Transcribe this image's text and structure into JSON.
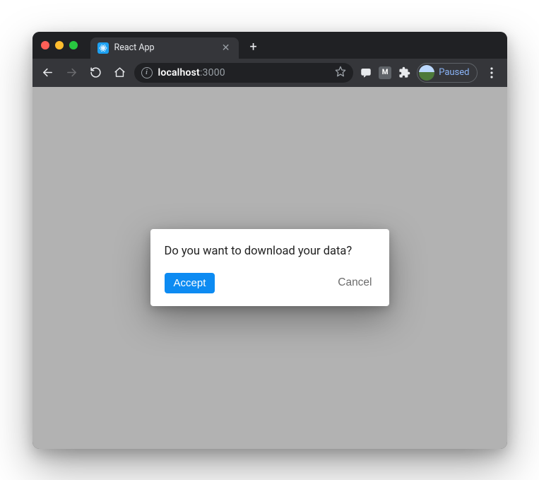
{
  "browser": {
    "tab": {
      "title": "React App"
    },
    "url": {
      "host": "localhost",
      "port": ":3000"
    },
    "profile": {
      "status": "Paused"
    },
    "extensions": {
      "gmail_label": "M"
    }
  },
  "dialog": {
    "message": "Do you want to download your data?",
    "accept_label": "Accept",
    "cancel_label": "Cancel"
  }
}
